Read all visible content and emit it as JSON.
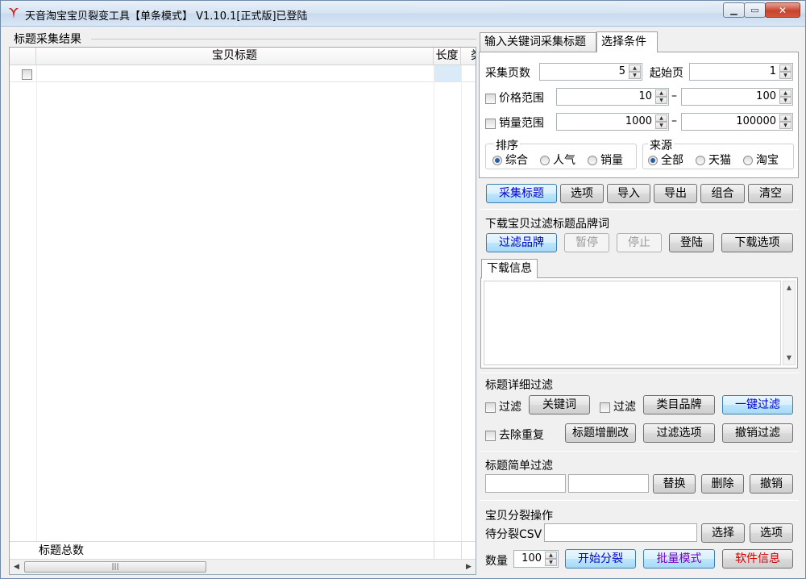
{
  "window": {
    "title": "天音淘宝宝贝裂变工具【单条模式】 V1.10.1[正式版]已登陆"
  },
  "left": {
    "group_label": "标题采集结果",
    "columns": [
      "宝贝标题",
      "长度",
      "类"
    ],
    "footer_label": "标题总数",
    "scroll_glyph": "|||"
  },
  "tabs": [
    {
      "label": "输入关键词采集标题"
    },
    {
      "label": "选择条件"
    }
  ],
  "conditions": {
    "pages_label": "采集页数",
    "pages_value": "5",
    "start_page_label": "起始页",
    "start_page_value": "1",
    "price_label": "价格范围",
    "price_min": "10",
    "price_max": "100",
    "sales_label": "销量范围",
    "sales_min": "1000",
    "sales_max": "100000",
    "dash": "–",
    "sort": {
      "title": "排序",
      "options": [
        "综合",
        "人气",
        "销量"
      ]
    },
    "source": {
      "title": "来源",
      "options": [
        "全部",
        "天猫",
        "淘宝"
      ]
    }
  },
  "main_buttons": [
    "采集标题",
    "选项",
    "导入",
    "导出",
    "组合",
    "清空"
  ],
  "download": {
    "title": "下载宝贝过滤标题品牌词",
    "buttons": [
      "过滤品牌",
      "暂停",
      "停止",
      "登陆",
      "下载选项"
    ],
    "info_tab": "下载信息"
  },
  "detail_filter": {
    "title": "标题详细过滤",
    "filter_label": "过滤",
    "keyword_button": "关键词",
    "category_button": "类目品牌",
    "one_click_button": "一键过滤",
    "dedupe_label": "去除重复",
    "edit_button": "标题增删改",
    "options_button": "过滤选项",
    "undo_button": "撤销过滤"
  },
  "simple_filter": {
    "title": "标题简单过滤",
    "replace_button": "替换",
    "delete_button": "删除",
    "undo_button": "撤销"
  },
  "split": {
    "title": "宝贝分裂操作",
    "csv_label": "待分裂CSV",
    "select_button": "选择",
    "options_button": "选项",
    "count_label": "数量",
    "count_value": "100",
    "start_button": "开始分裂",
    "batch_button": "批量模式",
    "info_button": "软件信息"
  },
  "colors": {
    "blue_text": "#0000cc",
    "purple_text": "#7a00c8",
    "red_text": "#d40000",
    "logo_red": "#d0201a"
  }
}
